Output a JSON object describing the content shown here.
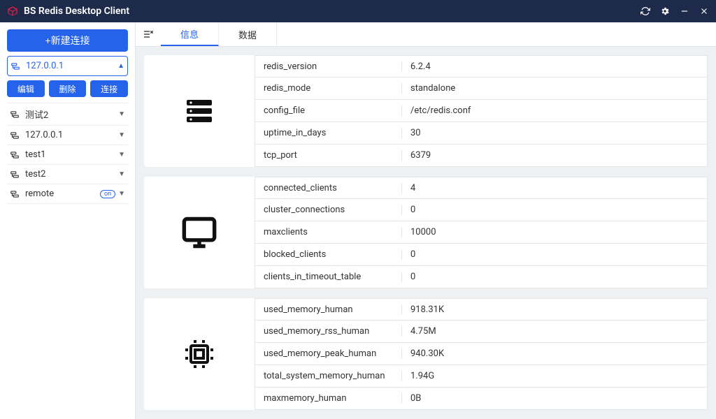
{
  "app": {
    "title": "BS Redis Desktop Client"
  },
  "sidebar": {
    "new_label": "+新建连接",
    "actions": {
      "edit": "编辑",
      "delete": "删除",
      "connect": "连接"
    },
    "connections": [
      {
        "label": "127.0.0.1",
        "active": true
      },
      {
        "label": "测试2"
      },
      {
        "label": "127.0.0.1"
      },
      {
        "label": "test1"
      },
      {
        "label": "test2"
      },
      {
        "label": "remote",
        "badge": "on"
      }
    ]
  },
  "tabs": {
    "info": "信息",
    "data": "数据"
  },
  "info": {
    "server": [
      {
        "key": "redis_version",
        "val": "6.2.4"
      },
      {
        "key": "redis_mode",
        "val": "standalone"
      },
      {
        "key": "config_file",
        "val": "/etc/redis.conf"
      },
      {
        "key": "uptime_in_days",
        "val": "30"
      },
      {
        "key": "tcp_port",
        "val": "6379"
      }
    ],
    "clients": [
      {
        "key": "connected_clients",
        "val": "4"
      },
      {
        "key": "cluster_connections",
        "val": "0"
      },
      {
        "key": "maxclients",
        "val": "10000"
      },
      {
        "key": "blocked_clients",
        "val": "0"
      },
      {
        "key": "clients_in_timeout_table",
        "val": "0"
      }
    ],
    "memory": [
      {
        "key": "used_memory_human",
        "val": "918.31K"
      },
      {
        "key": "used_memory_rss_human",
        "val": "4.75M"
      },
      {
        "key": "used_memory_peak_human",
        "val": "940.30K"
      },
      {
        "key": "total_system_memory_human",
        "val": "1.94G"
      },
      {
        "key": "maxmemory_human",
        "val": "0B"
      }
    ]
  }
}
